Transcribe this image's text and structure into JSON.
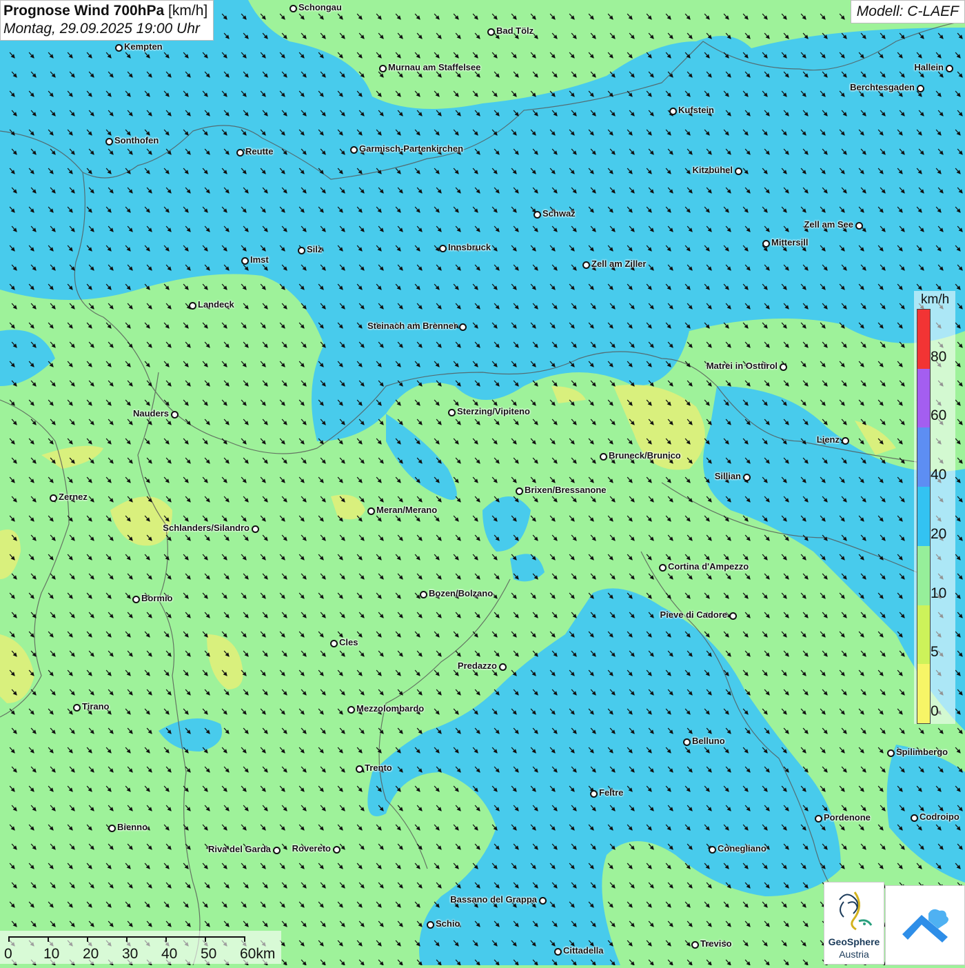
{
  "header": {
    "title_bold": "Prognose Wind 700hPa",
    "title_unit": "[km/h]",
    "subtitle": "Montag, 29.09.2025 19:00 Uhr"
  },
  "model_label": "Modell: C-LAEF",
  "legend": {
    "unit": "km/h",
    "ticks": [
      "80",
      "60",
      "40",
      "20",
      "10",
      "5",
      "0"
    ],
    "colors": [
      "#f23434",
      "#a45ef0",
      "#5d8ef3",
      "#33c3f2",
      "#96ef9a",
      "#cdf25a",
      "#f7f567"
    ]
  },
  "scale_bar": {
    "labels": [
      "0",
      "10",
      "20",
      "30",
      "40",
      "50",
      "60km"
    ]
  },
  "logo": {
    "name": "GeoSphere",
    "sub": "Austria",
    "icon": "geosphere-logo-icon"
  },
  "app_logo_icon": "app-mountain-icon",
  "map_colors": {
    "calm_green": "#9ef29a",
    "moderate_blue": "#43c8f0",
    "light_yellow": "#dff07a",
    "arrows": "#111111",
    "borders": "#555555"
  },
  "wind_direction": "north-west to south-east",
  "cities": [
    {
      "name": "Schongau"
    },
    {
      "name": "Bad Tölz"
    },
    {
      "name": "Kempten"
    },
    {
      "name": "Murnau am Staffelsee"
    },
    {
      "name": "Hallein"
    },
    {
      "name": "Berchtesgaden"
    },
    {
      "name": "Kufstein"
    },
    {
      "name": "Sonthofen"
    },
    {
      "name": "Reutte"
    },
    {
      "name": "Garmisch-Partenkirchen"
    },
    {
      "name": "Kitzbühel"
    },
    {
      "name": "Schwaz"
    },
    {
      "name": "Zell am See"
    },
    {
      "name": "Mittersill"
    },
    {
      "name": "Innsbruck"
    },
    {
      "name": "Silz"
    },
    {
      "name": "Imst"
    },
    {
      "name": "Zell am Ziller"
    },
    {
      "name": "Landeck"
    },
    {
      "name": "Steinach am Brenner"
    },
    {
      "name": "Matrei in Osttirol"
    },
    {
      "name": "Nauders"
    },
    {
      "name": "Sterzing/Vipiteno"
    },
    {
      "name": "Lienz"
    },
    {
      "name": "Bruneck/Brunico"
    },
    {
      "name": "Sillian"
    },
    {
      "name": "Zernez"
    },
    {
      "name": "Brixen/Bressanone"
    },
    {
      "name": "Meran/Merano"
    },
    {
      "name": "Schlanders/Silandro"
    },
    {
      "name": "Cortina d'Ampezzo"
    },
    {
      "name": "Bormio"
    },
    {
      "name": "Bozen/Bolzano"
    },
    {
      "name": "Pieve di Cadore"
    },
    {
      "name": "Cles"
    },
    {
      "name": "Predazzo"
    },
    {
      "name": "Tirano"
    },
    {
      "name": "Mezzolombardo"
    },
    {
      "name": "Belluno"
    },
    {
      "name": "Spilimbergo"
    },
    {
      "name": "Trento"
    },
    {
      "name": "Feltre"
    },
    {
      "name": "Pordenone"
    },
    {
      "name": "Codroipo"
    },
    {
      "name": "Bienno"
    },
    {
      "name": "Riva del Garda"
    },
    {
      "name": "Rovereto"
    },
    {
      "name": "Conegliano"
    },
    {
      "name": "Bassano del Grappa"
    },
    {
      "name": "Schio"
    },
    {
      "name": "Treviso"
    },
    {
      "name": "Cittadella"
    }
  ]
}
